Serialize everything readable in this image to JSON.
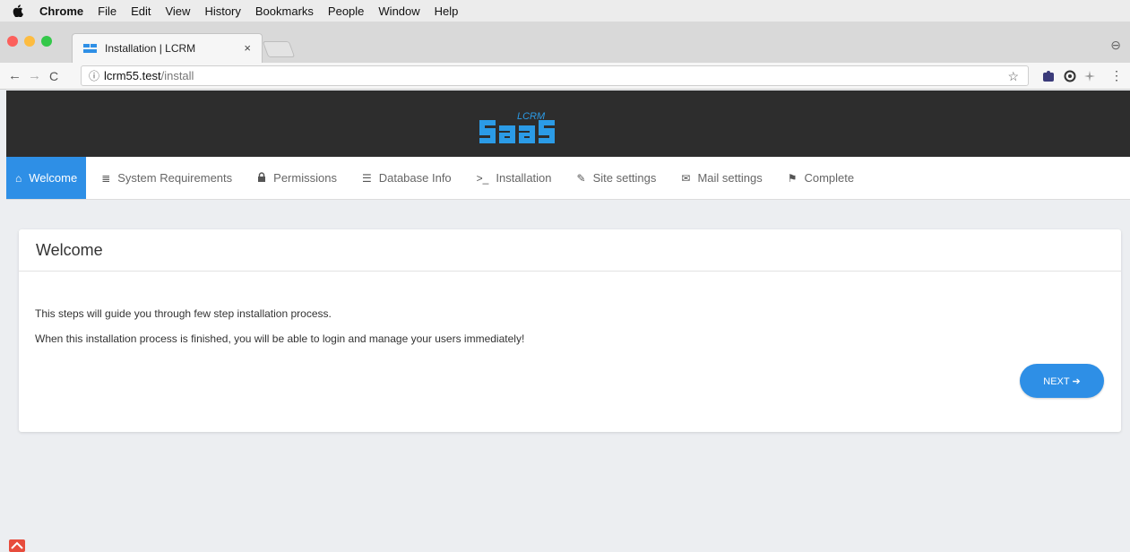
{
  "os_menu": {
    "app": "Chrome",
    "items": [
      "File",
      "Edit",
      "View",
      "History",
      "Bookmarks",
      "People",
      "Window",
      "Help"
    ]
  },
  "browser": {
    "tab_title": "Installation | LCRM",
    "tab_close": "×",
    "url_host": "lcrm55.test",
    "url_path": "/install",
    "info_icon": "ⓘ",
    "back": "←",
    "forward": "→",
    "reload": "C",
    "star": "☆",
    "menu": "⋮",
    "profile": "⊖"
  },
  "nav": [
    {
      "icon": "home-icon",
      "glyph": "⌂",
      "label": "Welcome",
      "active": true
    },
    {
      "icon": "list-icon",
      "glyph": "≣",
      "label": "System Requirements"
    },
    {
      "icon": "lock-icon",
      "glyph": "🔒",
      "label": "Permissions"
    },
    {
      "icon": "database-icon",
      "glyph": "☰",
      "label": "Database Info"
    },
    {
      "icon": "terminal-icon",
      "glyph": ">_",
      "label": "Installation"
    },
    {
      "icon": "wrench-icon",
      "glyph": "✎",
      "label": "Site settings"
    },
    {
      "icon": "envelope-icon",
      "glyph": "✉",
      "label": "Mail settings"
    },
    {
      "icon": "flag-icon",
      "glyph": "⚑",
      "label": "Complete"
    }
  ],
  "card": {
    "title": "Welcome",
    "line1": "This steps will guide you through few step installation process.",
    "line2": "When this installation process is finished, you will be able to login and manage your users immediately!",
    "next_label": "NEXT ➔"
  },
  "colors": {
    "accent": "#2e8fe6",
    "header_bg": "#2d2d2d"
  }
}
